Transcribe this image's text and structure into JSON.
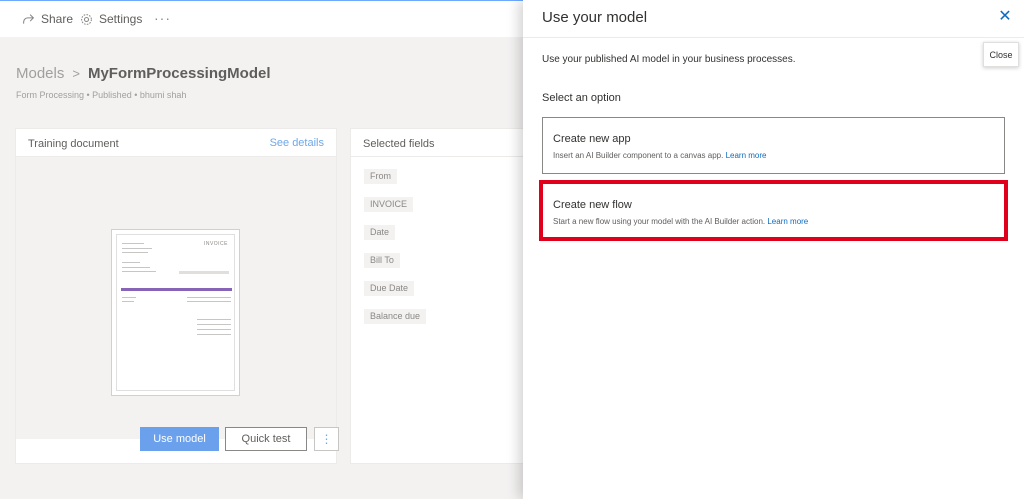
{
  "topbar": {
    "share_label": "Share",
    "settings_label": "Settings",
    "more_label": "···"
  },
  "breadcrumb": {
    "root": "Models",
    "separator": ">",
    "current": "MyFormProcessingModel"
  },
  "subtitle": "Form Processing • Published • bhumi shah",
  "training_card": {
    "title": "Training document",
    "link": "See details",
    "doc_heading": "INVOICE",
    "use_model_label": "Use model",
    "quick_test_label": "Quick test",
    "more_label": "⋮"
  },
  "fields_card": {
    "title": "Selected fields",
    "fields": [
      "From",
      "INVOICE",
      "Date",
      "Bill To",
      "Due Date",
      "Balance due"
    ]
  },
  "panel": {
    "title": "Use your model",
    "close_symbol": "✕",
    "description": "Use your published AI model in your business processes.",
    "section_label": "Select an option",
    "options": [
      {
        "title": "Create new app",
        "description": "Insert an AI Builder component to a canvas app.",
        "link": "Learn more"
      },
      {
        "title": "Create new flow",
        "description": "Start a new flow using your model with the AI Builder action.",
        "link": "Learn more"
      }
    ]
  },
  "tooltip": "Close",
  "colors": {
    "accent": "#0f6cbd",
    "highlight": "#e0001b",
    "primary_button": "#6aa0ec"
  }
}
